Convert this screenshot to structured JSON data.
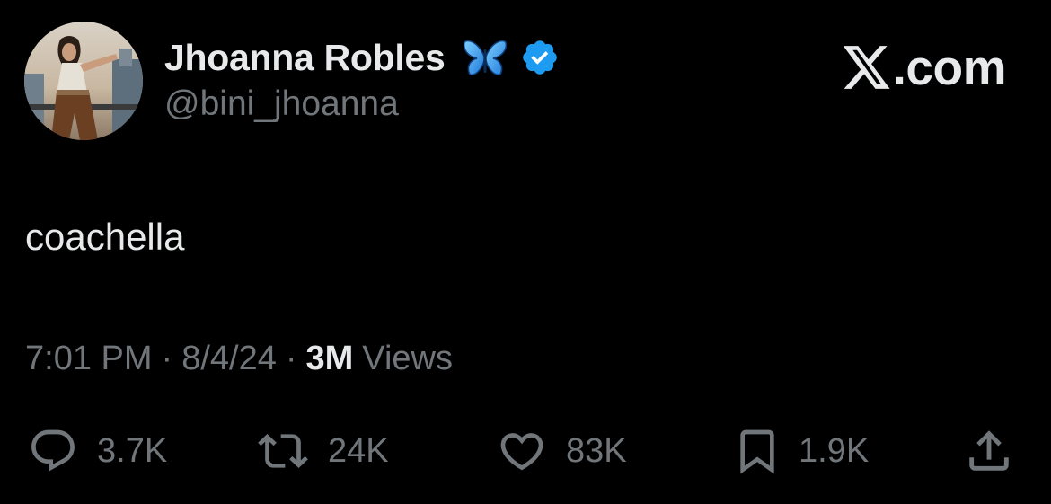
{
  "author": {
    "display_name": "Jhoanna Robles",
    "name_emoji": "butterfly-icon",
    "verified": true,
    "handle": "@bini_jhoanna"
  },
  "brand": {
    "text": ".com"
  },
  "tweet": {
    "text": "coachella"
  },
  "meta": {
    "time": "7:01 PM",
    "separator": "·",
    "date": "8/4/24",
    "views_count": "3M",
    "views_label": "Views"
  },
  "actions": {
    "replies": "3.7K",
    "reposts": "24K",
    "likes": "83K",
    "bookmarks": "1.9K"
  },
  "colors": {
    "background": "#000000",
    "primary_text": "#e7e9ea",
    "secondary_text": "#71767b",
    "verified_blue": "#1d9bf0"
  }
}
